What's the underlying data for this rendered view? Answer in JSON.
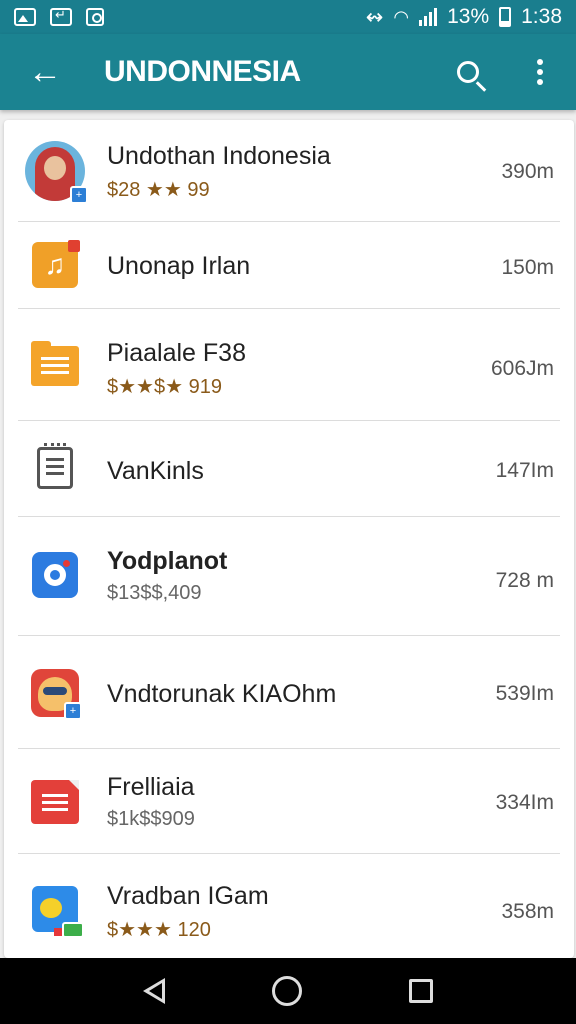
{
  "status_bar": {
    "battery": "13%",
    "time": "1:38"
  },
  "app_bar": {
    "title": "UNDONNESIA"
  },
  "items": [
    {
      "name": "Undothan Indonesia",
      "sub": "$28 ★★ 99",
      "size": "390m"
    },
    {
      "name": "Unonap Irlan",
      "sub": "",
      "size": "150m"
    },
    {
      "name": "Piaalale F38",
      "sub": "$★★$★ 919",
      "size": "606Jm"
    },
    {
      "name": "VanKinls",
      "sub": "",
      "size": "147Im"
    },
    {
      "name": "Yodplanot",
      "sub": "$13$$,409",
      "size": "728 m"
    },
    {
      "name": "Vndtorunak KIAOhm",
      "sub": "",
      "size": "539Im"
    },
    {
      "name": "Frelliaia",
      "sub": "$1k$$909",
      "size": "334Im"
    },
    {
      "name": "Vradban IGam",
      "sub": "$★★★ 120",
      "size": "358m"
    }
  ],
  "icons": [
    "avatar-icon",
    "music-app-icon",
    "folder-icon",
    "notepad-icon",
    "settings-app-icon",
    "mask-app-icon",
    "red-file-icon",
    "game-app-icon"
  ]
}
